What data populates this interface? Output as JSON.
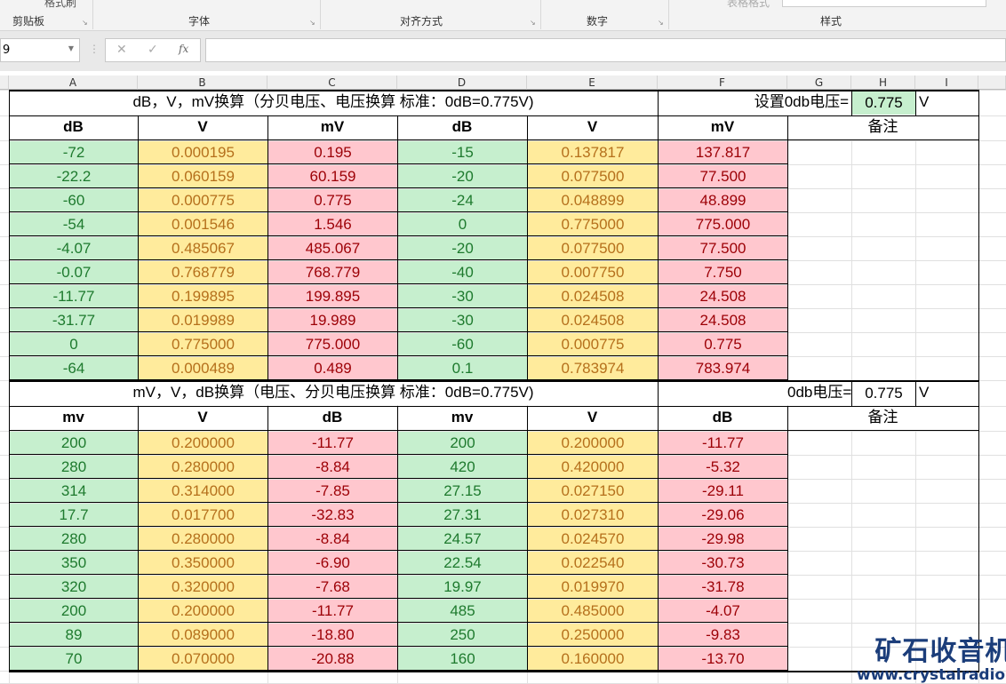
{
  "ribbon": {
    "groups": [
      "剪贴板",
      "字体",
      "对齐方式",
      "数字",
      "样式"
    ],
    "format_painter": "格式刷",
    "table_format": "表格格式"
  },
  "formula_bar": {
    "name_box": "9",
    "cancel": "✕",
    "enter": "✓",
    "fx": "fx",
    "formula": ""
  },
  "columns": [
    "A",
    "B",
    "C",
    "D",
    "E",
    "F",
    "G",
    "H",
    "I"
  ],
  "colors": {
    "green": "#c6efce",
    "yellow": "#ffeb9c",
    "red": "#ffc7ce"
  },
  "section1": {
    "title": "dB，V，mV换算（分贝电压、电压换算   标准：0dB=0.775V)",
    "setting_label": "设置0db电压=",
    "setting_value": "0.775",
    "setting_unit": "V",
    "headers": [
      "dB",
      "V",
      "mV",
      "dB",
      "V",
      "mV",
      "备注"
    ],
    "rows": [
      [
        "-72",
        "0.000195",
        "0.195",
        "-15",
        "0.137817",
        "137.817"
      ],
      [
        "-22.2",
        "0.060159",
        "60.159",
        "-20",
        "0.077500",
        "77.500"
      ],
      [
        "-60",
        "0.000775",
        "0.775",
        "-24",
        "0.048899",
        "48.899"
      ],
      [
        "-54",
        "0.001546",
        "1.546",
        "0",
        "0.775000",
        "775.000"
      ],
      [
        "-4.07",
        "0.485067",
        "485.067",
        "-20",
        "0.077500",
        "77.500"
      ],
      [
        "-0.07",
        "0.768779",
        "768.779",
        "-40",
        "0.007750",
        "7.750"
      ],
      [
        "-11.77",
        "0.199895",
        "199.895",
        "-30",
        "0.024508",
        "24.508"
      ],
      [
        "-31.77",
        "0.019989",
        "19.989",
        "-30",
        "0.024508",
        "24.508"
      ],
      [
        "0",
        "0.775000",
        "775.000",
        "-60",
        "0.000775",
        "0.775"
      ],
      [
        "-64",
        "0.000489",
        "0.489",
        "0.1",
        "0.783974",
        "783.974"
      ]
    ]
  },
  "section2": {
    "title": "mV，V，dB换算（电压、分贝电压换算   标准：0dB=0.775V)",
    "setting_label": "0db电压=",
    "setting_value": "0.775",
    "setting_unit": "V",
    "headers": [
      "mv",
      "V",
      "dB",
      "mv",
      "V",
      "dB",
      "备注"
    ],
    "rows": [
      [
        "200",
        "0.200000",
        "-11.77",
        "200",
        "0.200000",
        "-11.77"
      ],
      [
        "280",
        "0.280000",
        "-8.84",
        "420",
        "0.420000",
        "-5.32"
      ],
      [
        "314",
        "0.314000",
        "-7.85",
        "27.15",
        "0.027150",
        "-29.11"
      ],
      [
        "17.7",
        "0.017700",
        "-32.83",
        "27.31",
        "0.027310",
        "-29.06"
      ],
      [
        "280",
        "0.280000",
        "-8.84",
        "24.57",
        "0.024570",
        "-29.98"
      ],
      [
        "350",
        "0.350000",
        "-6.90",
        "22.54",
        "0.022540",
        "-30.73"
      ],
      [
        "320",
        "0.320000",
        "-7.68",
        "19.97",
        "0.019970",
        "-31.78"
      ],
      [
        "200",
        "0.200000",
        "-11.77",
        "485",
        "0.485000",
        "-4.07"
      ],
      [
        "89",
        "0.089000",
        "-18.80",
        "250",
        "0.250000",
        "-9.83"
      ],
      [
        "70",
        "0.070000",
        "-20.88",
        "160",
        "0.160000",
        "-13.70"
      ]
    ]
  },
  "watermark": {
    "title": "矿石收音机",
    "url": "www.crystalradio.cn"
  }
}
